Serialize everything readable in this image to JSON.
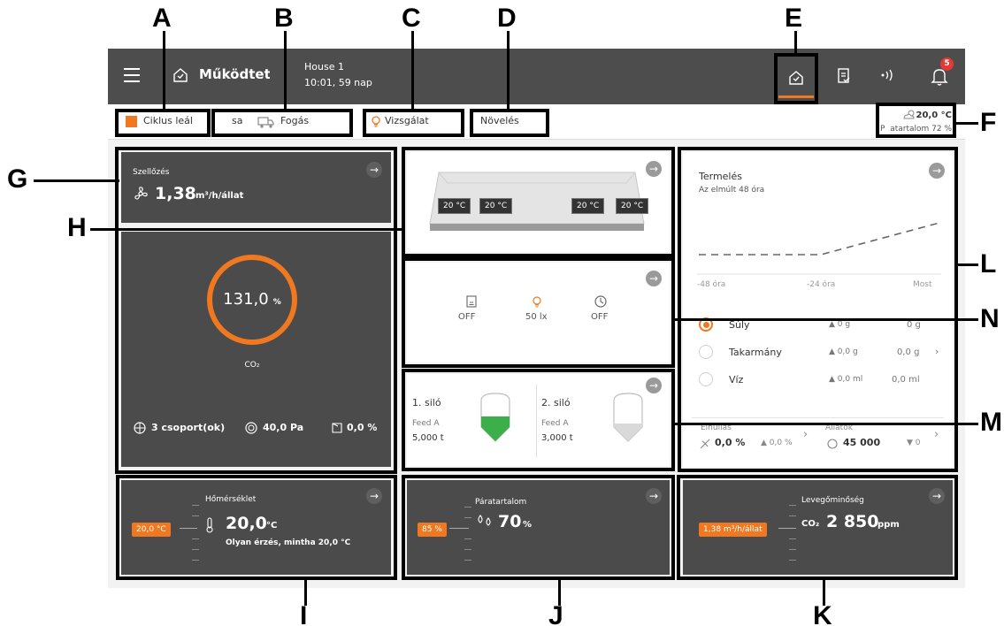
{
  "callouts": {
    "A": "A",
    "B": "B",
    "C": "C",
    "D": "D",
    "E": "E",
    "F": "F",
    "G": "G",
    "H": "H",
    "I": "I",
    "J": "J",
    "K": "K",
    "L": "L",
    "M": "M",
    "N": "N"
  },
  "header": {
    "title": "Működtetés",
    "house": "House 1",
    "time_day": "10:01, 59 nap",
    "notification_count": "5"
  },
  "subbar": {
    "cycle_label": "Ciklus leál",
    "cycle_cont": "sa",
    "catch_label": "Fogás",
    "inspect_label": "Vizsgálat",
    "grow_label": "Növelés",
    "weather_temp": "20,0 °C",
    "weather_humidity": "P  atartalom 72 %"
  },
  "ventilation": {
    "title": "Szellőzés",
    "value": "1,38",
    "unit": "m³/h/állat",
    "gauge_value": "131,0",
    "gauge_unit": "%",
    "gauge_label": "CO₂",
    "groups": "3 csoport(ok)",
    "pressure": "40,0 Pa",
    "opening": "0,0 %"
  },
  "house_panel": {
    "chips": [
      "20 °C",
      "20 °C",
      "20 °C",
      "20 °C"
    ]
  },
  "devices": {
    "items": [
      {
        "icon": "feeder-icon",
        "label": "OFF"
      },
      {
        "icon": "light-bulb-icon",
        "label": "50 lx"
      },
      {
        "icon": "timer-icon",
        "label": "OFF"
      }
    ]
  },
  "silos": {
    "items": [
      {
        "name": "1. siló",
        "feed": "Feed A",
        "amount": "5,000 t"
      },
      {
        "name": "2. siló",
        "feed": "Feed A",
        "amount": "3,000 t"
      }
    ]
  },
  "production": {
    "title": "Termelés",
    "subtitle": "Az elmúlt 48 óra",
    "axis": [
      "-48 óra",
      "-24 óra",
      "Most"
    ],
    "rows": [
      {
        "label": "Súly",
        "delta": "▲ 0 g",
        "value": "0 g"
      },
      {
        "label": "Takarmány",
        "delta": "▲ 0,0 g",
        "value": "0,0 g"
      },
      {
        "label": "Víz",
        "delta": "▲ 0,0 ml",
        "value": "0,0 ml"
      }
    ],
    "mortality_label": "Elhullás",
    "mortality_value": "0,0 %",
    "mortality_delta": "▲ 0,0 %",
    "animals_label": "Állatok",
    "animals_value": "45 000",
    "animals_delta": "▼ 0"
  },
  "temperature": {
    "title": "Hőmérséklet",
    "setpoint": "20,0 °C",
    "value": "20,0",
    "unit": "°C",
    "feels": "Olyan érzés, mintha 20,0 °C"
  },
  "humidity": {
    "title": "Páratartalom",
    "setpoint": "85 %",
    "value": "70",
    "unit": "%"
  },
  "air_quality": {
    "title": "Levegőminőség",
    "setpoint": "1,38 m³/h/állat",
    "prefix": "CO₂",
    "value": "2 850",
    "unit": "ppm"
  },
  "colors": {
    "accent": "#f07820",
    "green": "#3cae4a",
    "panel": "#4b4b4b",
    "topbar": "#4d4d4d"
  }
}
